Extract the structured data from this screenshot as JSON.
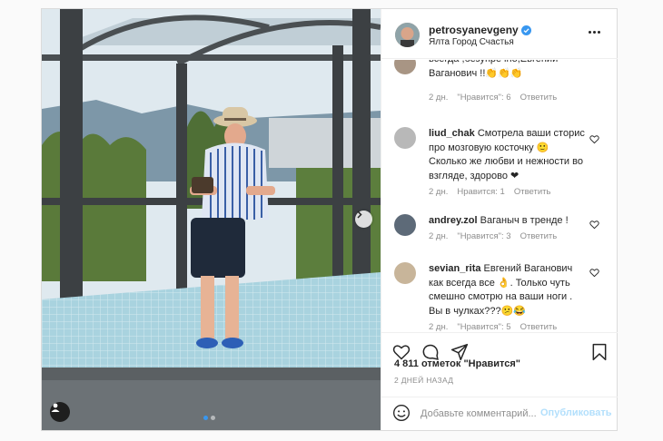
{
  "post": {
    "username": "petrosyanevgeny",
    "location": "Ялта Город Счастья",
    "verified": true,
    "likes": "4 811 отметок \"Нравится\"",
    "date": "2 ДНЕЙ НАЗАД",
    "carousel": {
      "slides": 2,
      "active": 1
    }
  },
  "comments": [
    {
      "user": "",
      "text": "всегда ,безупречно,Евгений Ваганович !!👏👏👏",
      "age": "2 дн.",
      "likes": "\"Нравится\": 6",
      "reply": "Ответить"
    },
    {
      "user": "liud_chak",
      "text": "Смотрела ваши сторис про мозговую косточку 🙂 Сколько же любви и нежности во взгляде, здорово ❤",
      "age": "2 дн.",
      "likes": "Нравится: 1",
      "reply": "Ответить"
    },
    {
      "user": "andrey.zol",
      "text": "Ваганыч в тренде !",
      "age": "2 дн.",
      "likes": "\"Нравится\": 3",
      "reply": "Ответить"
    },
    {
      "user": "sevian_rita",
      "text": "Евгений Ваганович как всегда все 👌. Только чуть смешно смотрю на ваши ноги . Вы в чулках???😕😂",
      "age": "2 дн.",
      "likes": "\"Нравится\": 5",
      "reply": "Ответить"
    }
  ],
  "composer": {
    "placeholder": "Добавьте комментарий...",
    "submit": "Опубликовать"
  },
  "colors": {
    "accent": "#3897f0",
    "submit_disabled": "#b2dffc",
    "heart_red": "#ed4956",
    "secondary_text": "#8e8e8e"
  },
  "icons": {
    "header": [
      "verified-badge-icon",
      "more-options-icon"
    ],
    "actions": [
      "heart-icon",
      "comment-icon",
      "share-icon",
      "bookmark-icon"
    ],
    "composer": [
      "emoji-icon"
    ],
    "photo": [
      "user-tag-icon",
      "next-arrow-icon"
    ]
  }
}
